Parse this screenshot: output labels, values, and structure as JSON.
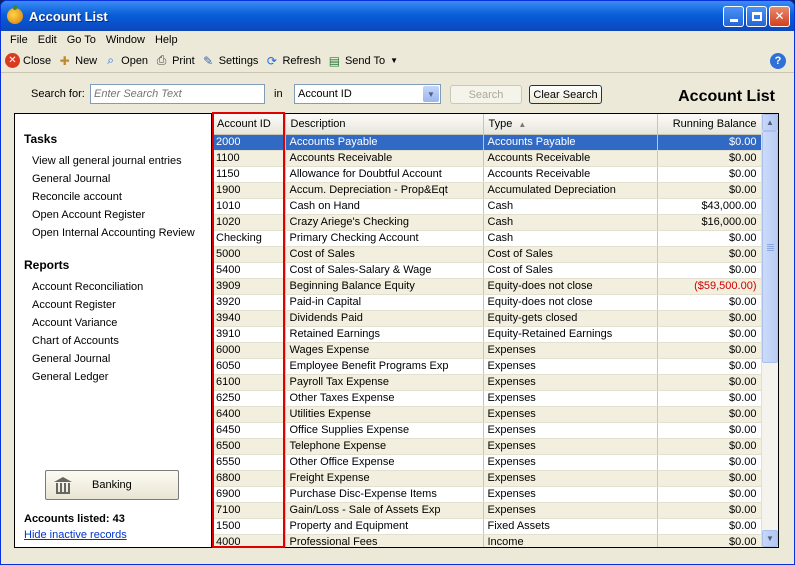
{
  "window": {
    "title": "Account List"
  },
  "menu": [
    "File",
    "Edit",
    "Go To",
    "Window",
    "Help"
  ],
  "toolbar": [
    {
      "label": "Close",
      "icon": "close-icon"
    },
    {
      "label": "New",
      "icon": "new-icon"
    },
    {
      "label": "Open",
      "icon": "open-icon"
    },
    {
      "label": "Print",
      "icon": "print-icon"
    },
    {
      "label": "Settings",
      "icon": "settings-icon"
    },
    {
      "label": "Refresh",
      "icon": "refresh-icon"
    },
    {
      "label": "Send To",
      "icon": "send-to-icon"
    }
  ],
  "search": {
    "label": "Search for:",
    "placeholder": "Enter Search Text",
    "in_label": "in",
    "field": "Account ID",
    "search_button": "Search",
    "clear_button": "Clear Search"
  },
  "heading": "Account List",
  "tasks": {
    "title": "Tasks",
    "items": [
      "View all general journal entries",
      "General Journal",
      "Reconcile account",
      "Open Account Register",
      "Open Internal Accounting Review"
    ]
  },
  "reports": {
    "title": "Reports",
    "items": [
      "Account Reconciliation",
      "Account Register",
      "Account Variance",
      "Chart of Accounts",
      "General Journal",
      "General Ledger"
    ]
  },
  "banking_button": "Banking",
  "accounts_listed": "Accounts listed: 43",
  "hide_inactive": "Hide inactive records",
  "columns": [
    "Account ID",
    "Description",
    "Type",
    "Running Balance"
  ],
  "rows": [
    [
      "2000",
      "Accounts Payable",
      "Accounts Payable",
      "$0.00"
    ],
    [
      "1100",
      "Accounts Receivable",
      "Accounts Receivable",
      "$0.00"
    ],
    [
      "1150",
      "Allowance for Doubtful Account",
      "Accounts Receivable",
      "$0.00"
    ],
    [
      "1900",
      "Accum. Depreciation - Prop&Eqt",
      "Accumulated Depreciation",
      "$0.00"
    ],
    [
      "1010",
      "Cash on Hand",
      "Cash",
      "$43,000.00"
    ],
    [
      "1020",
      "Crazy Ariege's Checking",
      "Cash",
      "$16,000.00"
    ],
    [
      "Checking",
      "Primary Checking Account",
      "Cash",
      "$0.00"
    ],
    [
      "5000",
      "Cost of Sales",
      "Cost of Sales",
      "$0.00"
    ],
    [
      "5400",
      "Cost of Sales-Salary & Wage",
      "Cost of Sales",
      "$0.00"
    ],
    [
      "3909",
      "Beginning Balance Equity",
      "Equity-does not close",
      "($59,500.00)"
    ],
    [
      "3920",
      "Paid-in Capital",
      "Equity-does not close",
      "$0.00"
    ],
    [
      "3940",
      "Dividends Paid",
      "Equity-gets closed",
      "$0.00"
    ],
    [
      "3910",
      "Retained Earnings",
      "Equity-Retained Earnings",
      "$0.00"
    ],
    [
      "6000",
      "Wages Expense",
      "Expenses",
      "$0.00"
    ],
    [
      "6050",
      "Employee Benefit Programs Exp",
      "Expenses",
      "$0.00"
    ],
    [
      "6100",
      "Payroll Tax Expense",
      "Expenses",
      "$0.00"
    ],
    [
      "6250",
      "Other Taxes Expense",
      "Expenses",
      "$0.00"
    ],
    [
      "6400",
      "Utilities Expense",
      "Expenses",
      "$0.00"
    ],
    [
      "6450",
      "Office Supplies Expense",
      "Expenses",
      "$0.00"
    ],
    [
      "6500",
      "Telephone Expense",
      "Expenses",
      "$0.00"
    ],
    [
      "6550",
      "Other Office Expense",
      "Expenses",
      "$0.00"
    ],
    [
      "6800",
      "Freight Expense",
      "Expenses",
      "$0.00"
    ],
    [
      "6900",
      "Purchase Disc-Expense Items",
      "Expenses",
      "$0.00"
    ],
    [
      "7100",
      "Gain/Loss - Sale of Assets Exp",
      "Expenses",
      "$0.00"
    ],
    [
      "1500",
      "Property and Equipment",
      "Fixed Assets",
      "$0.00"
    ],
    [
      "4000",
      "Professional Fees",
      "Income",
      "$0.00"
    ]
  ],
  "colors": {
    "selection": "#316ac5",
    "negative": "#d00000",
    "highlight": "#e00000"
  }
}
